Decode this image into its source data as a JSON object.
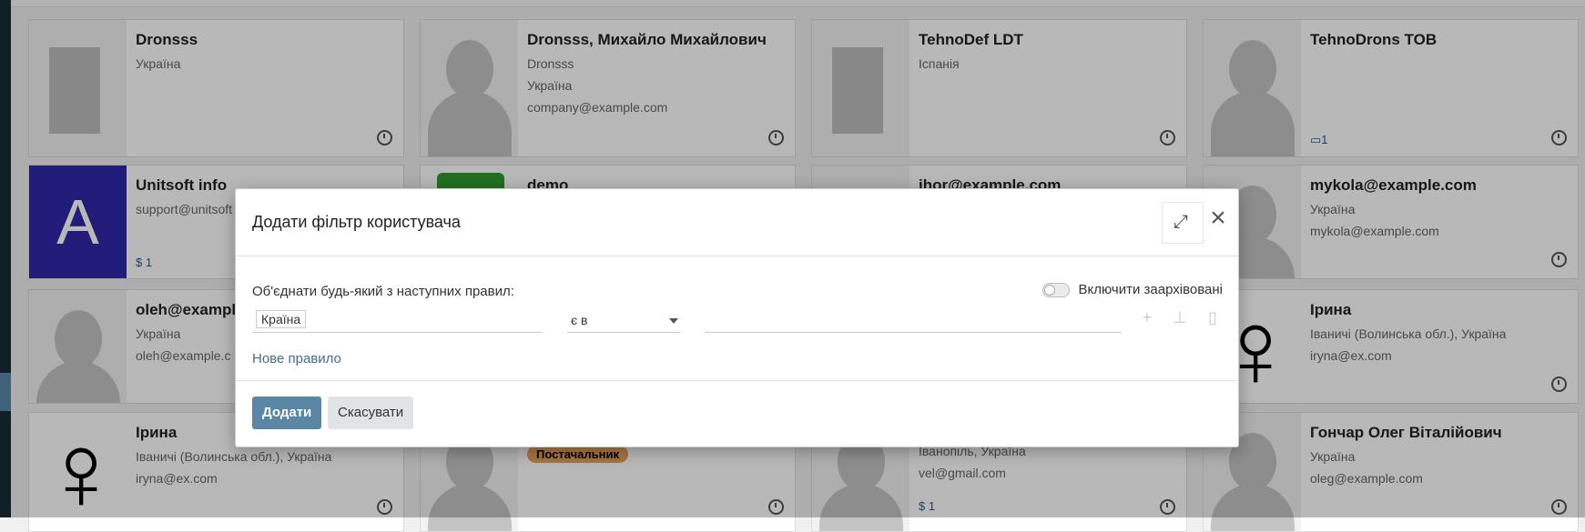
{
  "cards": [
    {
      "name": "Dronsss",
      "lines": [
        "Україна"
      ],
      "badge": ""
    },
    {
      "name": "Dronsss, Михайло Михайлович",
      "lines": [
        "Dronsss",
        "Україна",
        "company@example.com"
      ],
      "badge": ""
    },
    {
      "name": "TehnoDef LDT",
      "lines": [
        "Іспанія"
      ],
      "badge": ""
    },
    {
      "name": "TehnoDrons TOB",
      "lines": [],
      "badge": "1"
    },
    {
      "name": "Unitsoft info",
      "lines": [
        "support@unitsoft"
      ],
      "badge": "$ 1",
      "avatar_letter": "A"
    },
    {
      "name": "demo",
      "lines": [],
      "badge": ""
    },
    {
      "name": "ihor@example.com",
      "lines": [],
      "badge": ""
    },
    {
      "name": "mykola@example.com",
      "lines": [
        "Україна",
        "mykola@example.com"
      ],
      "badge": ""
    },
    {
      "name": "oleh@example",
      "lines": [
        "Україна",
        "oleh@example.c"
      ],
      "badge": ""
    },
    {
      "name": "Ірина",
      "lines": [
        "Іваничі (Волинська обл.), Україна",
        "iryna@ex.com"
      ],
      "badge": ""
    },
    {
      "name": "Ірина",
      "lines": [
        "Іваничі (Волинська обл.), Україна",
        "iryna@ex.com"
      ],
      "badge": ""
    },
    {
      "name": "",
      "lines": [],
      "tag": "Постачальник"
    },
    {
      "name": "",
      "lines": [
        "Іванопіль, Україна",
        "vel@gmail.com"
      ],
      "badge": "$ 1"
    },
    {
      "name": "Гончар Олег Віталійович",
      "lines": [
        "Україна",
        "oleg@example.com"
      ],
      "badge": ""
    }
  ],
  "modal": {
    "title": "Додати фільтр користувача",
    "expand_icon": "expand-icon",
    "close_icon": "close-icon",
    "match_label": "Об'єднати будь-який з наступних правил:",
    "include_archived_label": "Включити заархівовані",
    "include_archived": false,
    "rule": {
      "field": "Країна",
      "operator": "є в",
      "value": ""
    },
    "new_rule_label": "Нове правило",
    "add_button": "Додати",
    "cancel_button": "Скасувати"
  }
}
